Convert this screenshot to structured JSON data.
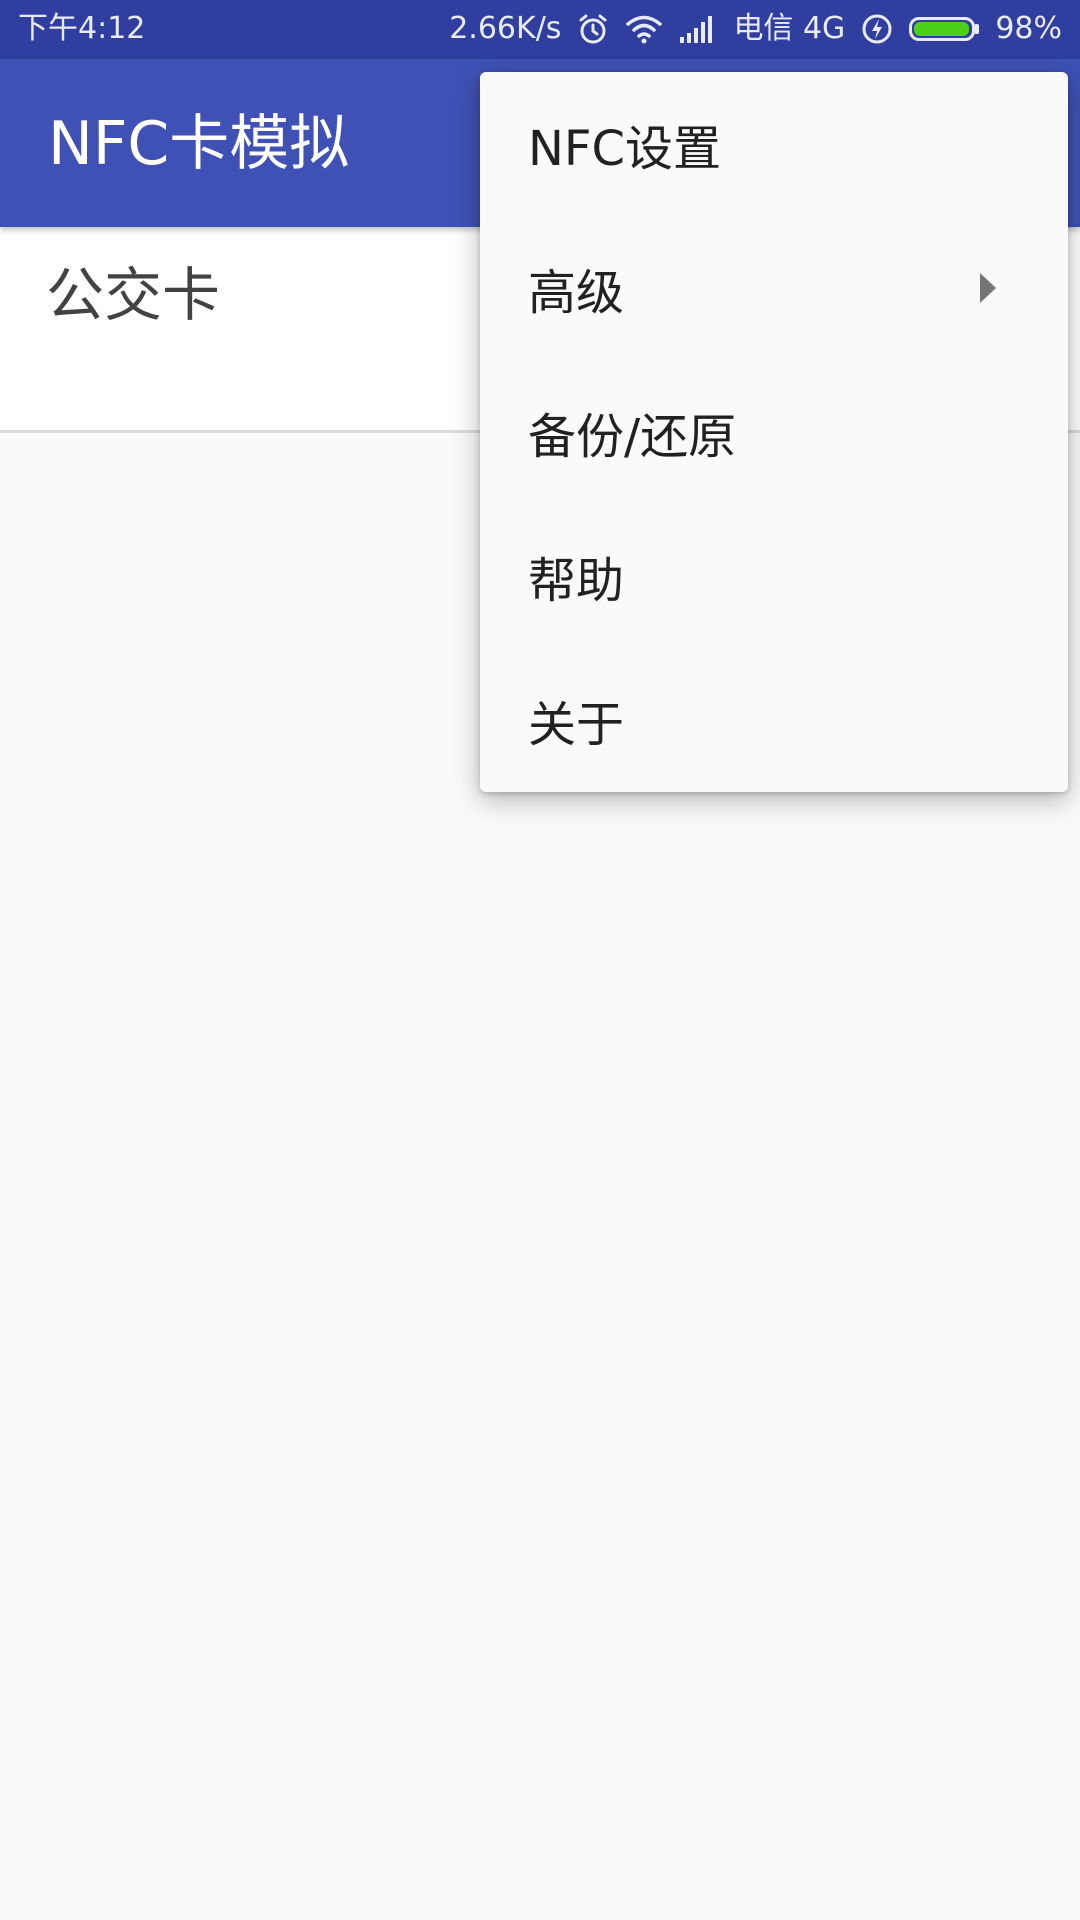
{
  "status_bar": {
    "time": "下午4:12",
    "net_speed": "2.66K/s",
    "carrier": "电信 4G",
    "battery_percent": "98%",
    "battery_level": 0.98,
    "icons": [
      "alarm-icon",
      "wifi-icon",
      "signal-icon",
      "charging-icon",
      "battery-icon"
    ],
    "colors": {
      "background": "#303f9f",
      "battery_fill": "#4cd01a"
    }
  },
  "app_bar": {
    "title": "NFC卡模拟",
    "color": "#3f51b5"
  },
  "list": {
    "items": [
      {
        "label": "公交卡"
      }
    ]
  },
  "menu": {
    "items": [
      {
        "label": "NFC设置"
      },
      {
        "label": "高级",
        "has_submenu": true,
        "icon": "submenu-arrow-icon"
      },
      {
        "label": "备份/还原"
      },
      {
        "label": "帮助"
      },
      {
        "label": "关于"
      }
    ]
  }
}
